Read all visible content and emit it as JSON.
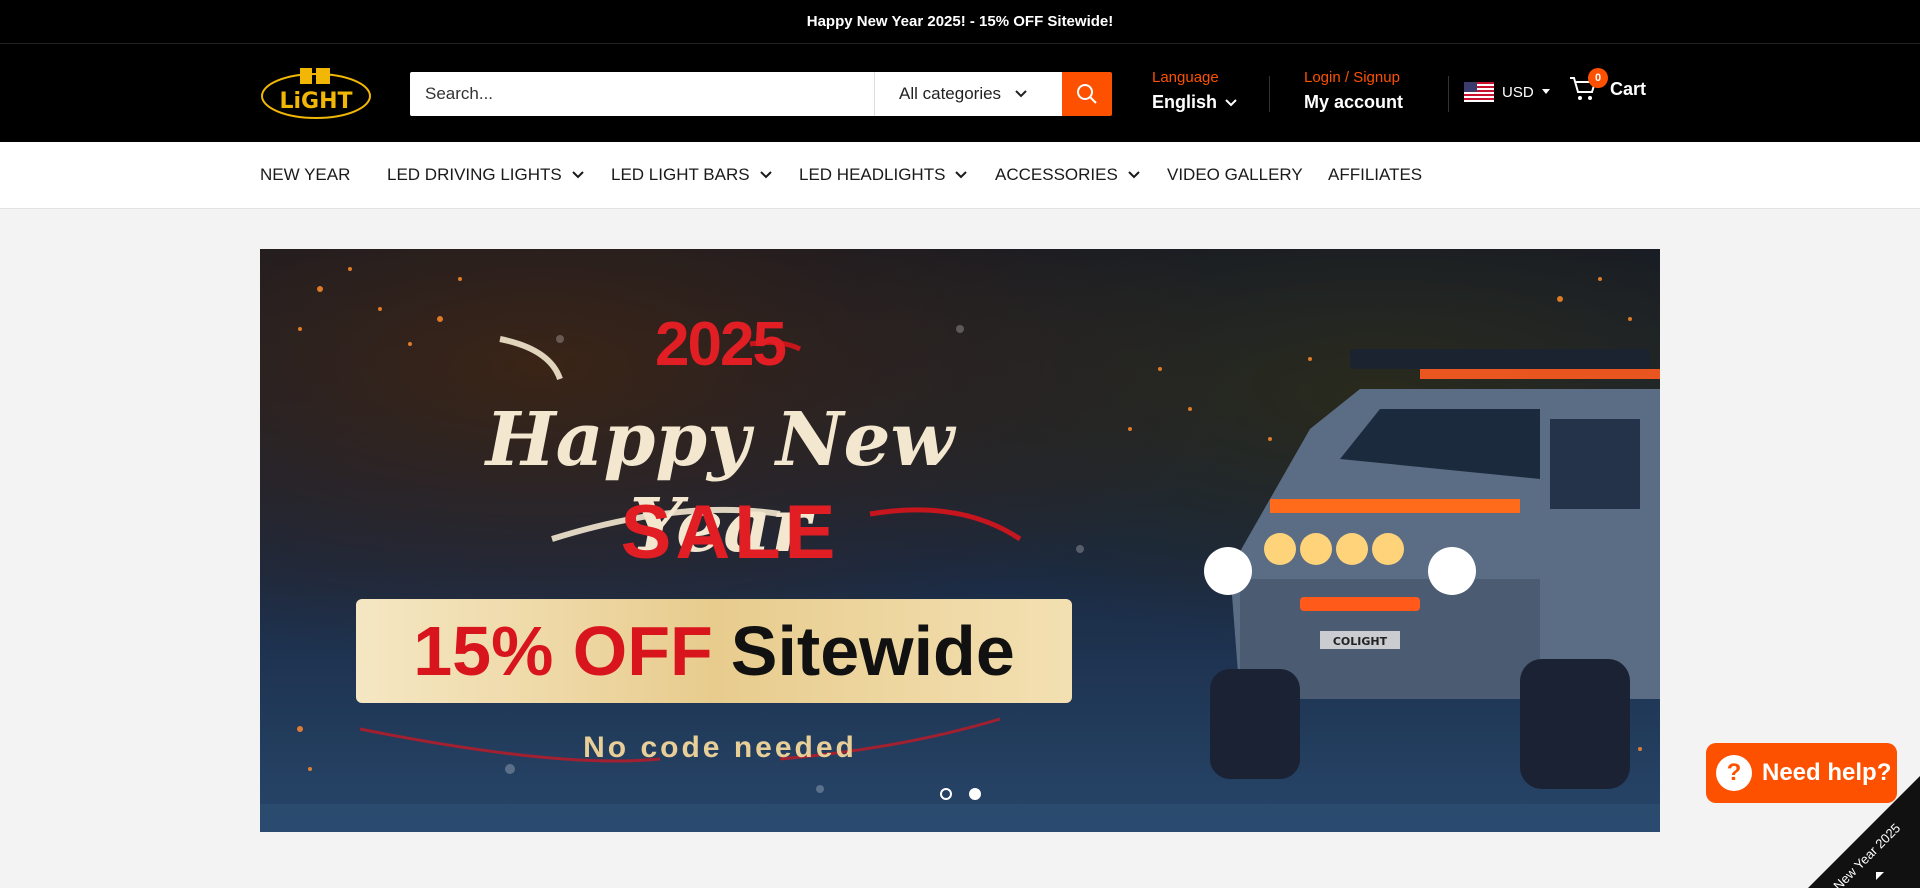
{
  "announcement": "Happy New Year 2025! - 15% OFF Sitewide!",
  "logo_text": "COLIGHT",
  "search": {
    "placeholder": "Search...",
    "category": "All categories"
  },
  "language": {
    "label": "Language",
    "value": "English"
  },
  "account": {
    "label": "Login / Signup",
    "value": "My account"
  },
  "currency": "USD",
  "cart": {
    "label": "Cart",
    "count": "0"
  },
  "nav": [
    {
      "label": "NEW YEAR"
    },
    {
      "label": "LED DRIVING LIGHTS"
    },
    {
      "label": "LED LIGHT BARS"
    },
    {
      "label": "LED HEADLIGHTS"
    },
    {
      "label": "ACCESSORIES"
    },
    {
      "label": "VIDEO GALLERY"
    },
    {
      "label": "AFFILIATES"
    }
  ],
  "hero": {
    "year": "2025",
    "headline": "Happy New Year",
    "sale": "SALE",
    "offer_percent": "15% OFF",
    "offer_scope": "Sitewide",
    "subtext": "No code needed",
    "slide_count": 2,
    "active_slide": 2
  },
  "help_button": "Need help?",
  "corner_ribbon": "New Year 2025",
  "colors": {
    "accent": "#fd5100",
    "header_bg": "#000000",
    "sale_red": "#e01e24"
  }
}
